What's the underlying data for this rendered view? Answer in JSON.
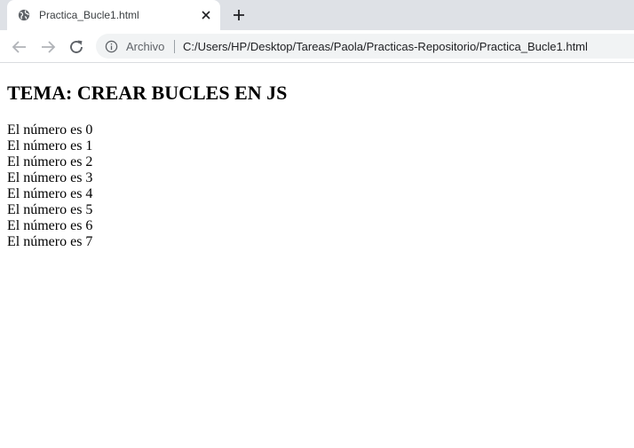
{
  "tab": {
    "title": "Practica_Bucle1.html",
    "favicon": "globe-icon"
  },
  "toolbar": {
    "scheme_label": "Archivo",
    "url": "C:/Users/HP/Desktop/Tareas/Paola/Practicas-Repositorio/Practica_Bucle1.html"
  },
  "page": {
    "heading": "TEMA: CREAR BUCLES EN JS",
    "lines": [
      "El número es 0",
      "El número es 1",
      "El número es 2",
      "El número es 3",
      "El número es 4",
      "El número es 5",
      "El número es 6",
      "El número es 7"
    ]
  },
  "colors": {
    "tabstrip_bg": "#dee1e6",
    "omnibox_bg": "#f1f3f4",
    "icon_gray": "#5f6368"
  }
}
